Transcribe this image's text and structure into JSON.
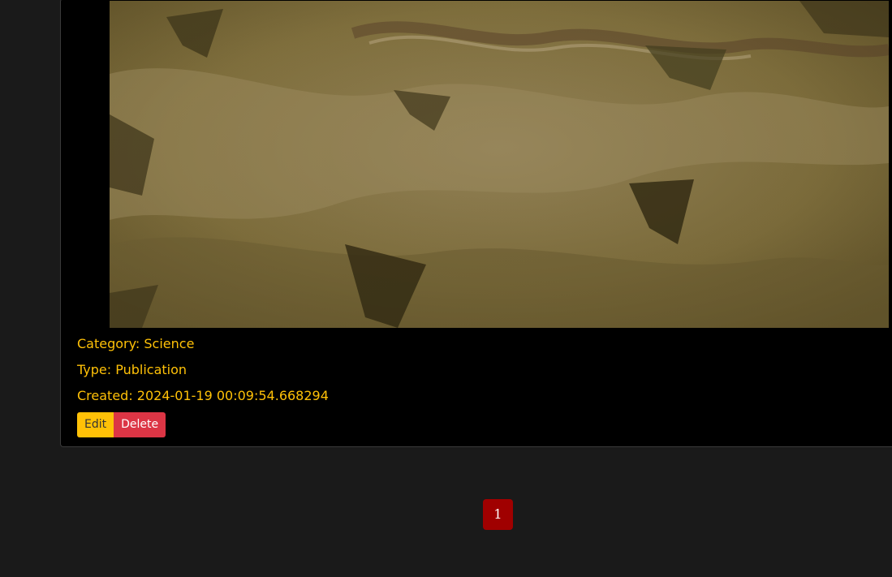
{
  "card": {
    "image_alt": "fabric-photo",
    "category_label": "Category: Science",
    "type_label": "Type: Publication",
    "created_label": "Created: 2024-01-19 00:09:54.668294",
    "edit_label": "Edit",
    "delete_label": "Delete"
  },
  "pagination": {
    "current_page": "1"
  },
  "colors": {
    "background": "#1a1a1a",
    "card_background": "#000000",
    "meta_text": "#ffc107",
    "edit_button": "#ffc107",
    "delete_button": "#dc3545",
    "page_button": "#a00000"
  }
}
